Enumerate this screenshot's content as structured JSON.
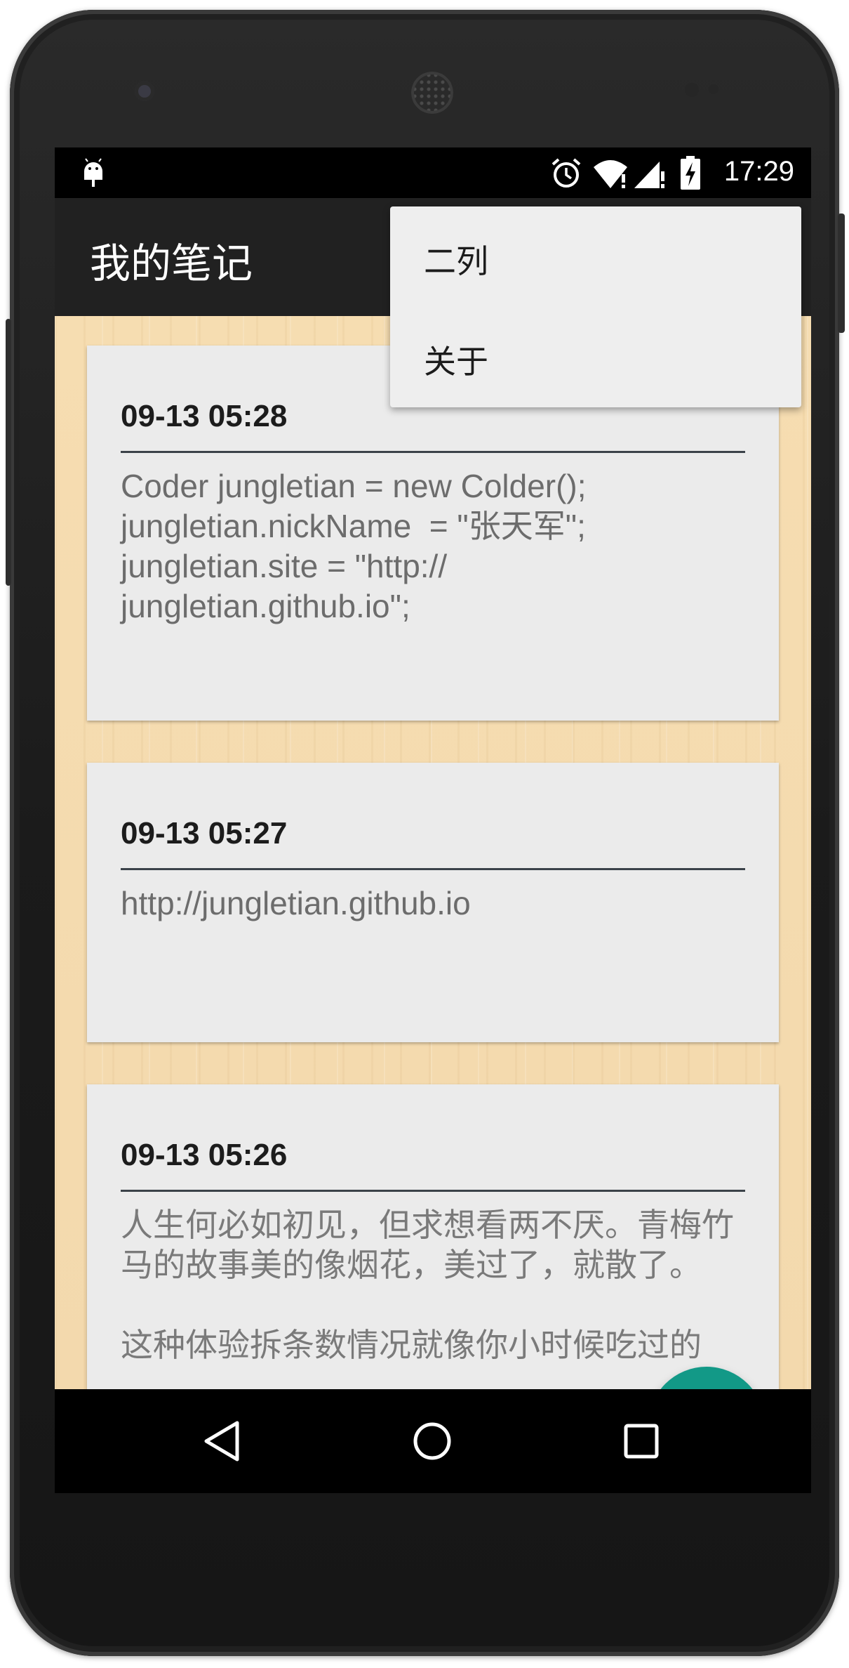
{
  "status_bar": {
    "time": "17:29",
    "icons": [
      "android-debug-icon",
      "alarm-icon",
      "wifi-icon",
      "signal-icon",
      "battery-charging-icon"
    ]
  },
  "app_bar": {
    "title": "我的笔记"
  },
  "overflow_menu": {
    "items": [
      {
        "label": "二列"
      },
      {
        "label": "关于"
      }
    ]
  },
  "notes": [
    {
      "date": "09-13 05:28",
      "body": "Coder jungletian = new Colder();\njungletian.nickName  = \"张天军\";\njungletian.site = \"http://\njungletian.github.io\";"
    },
    {
      "date": "09-13 05:27",
      "body": "http://jungletian.github.io"
    },
    {
      "date": "09-13 05:26",
      "body": "人生何必如初见，但求想看两不厌。青梅竹马的故事美的像烟花，美过了，就散了。\n\n这种体验拆条数情况就像你小时候吃过的"
    }
  ],
  "fab": {
    "icon": "new-note-icon"
  },
  "nav_bar": {
    "icons": [
      "back-icon",
      "home-icon",
      "recents-icon"
    ]
  },
  "colors": {
    "app_bar": "#212121",
    "fab": "#129987",
    "card": "#ebebeb",
    "wood": "#f6ddb1"
  }
}
